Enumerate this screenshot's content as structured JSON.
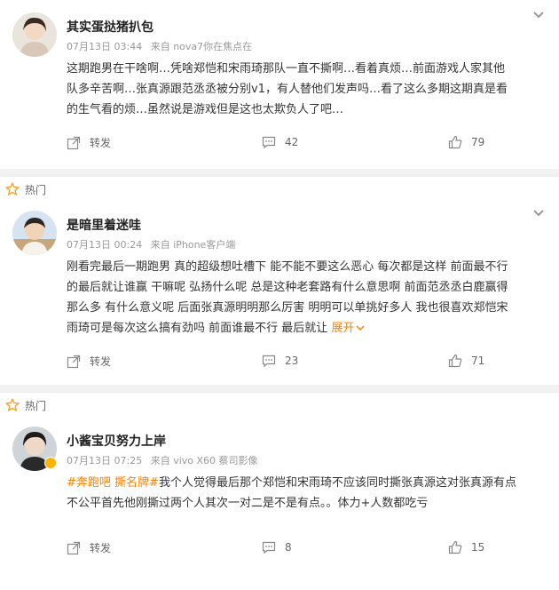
{
  "comments": [
    {
      "name": "其实蛋挞猪扒包",
      "date": "07月13日 03:44",
      "source": "来自 nova7你在焦点在",
      "text_lines": [
        "这期跑男在干啥啊…凭啥郑恺和宋雨琦那队一直不撕啊…看着真烦…前面游戏人家其他",
        "队多辛苦啊…张真源跟范丞丞被分别v1，有人替他们发声吗…看了这么多期这期真是看",
        "的生气看的烦…虽然说是游戏但是这也太欺负人了吧…"
      ],
      "repost_label": "转发",
      "comment_count": "42",
      "like_count": "79"
    },
    {
      "hot_label": "热门",
      "name": "是暗里着迷哇",
      "date": "07月13日 00:24",
      "source": "来自 iPhone客户端",
      "text_lines": [
        "刚看完最后一期跑男 真的超级想吐槽下 能不能不要这么恶心 每次都是这样 前面最不行",
        "的最后就让谁赢 干嘛呢 弘扬什么呢 总是这种老套路有什么意思啊 前面范丞丞白鹿赢得",
        "那么多 有什么意义呢 后面张真源明明那么厉害 明明可以单挑好多人 我也很喜欢郑恺宋",
        "雨琦可是每次这么搞有劲吗 前面谁最不行 最后就让 "
      ],
      "expand_label": "展开",
      "repost_label": "转发",
      "comment_count": "23",
      "like_count": "71"
    },
    {
      "hot_label": "热门",
      "name": "小酱宝贝努力上岸",
      "date": "07月13日 07:25",
      "source": "来自 vivo X60 蔡司影像",
      "tags": [
        "#奔跑吧",
        "撕名牌#"
      ],
      "text_lines": [
        "我个人觉得最后那个郑恺和宋雨琦不应该同时撕张真源这对张真源有点",
        "不公平首先他刚撕过两个人其次一对二是不是有点。。体力+人数都吃亏"
      ],
      "repost_label": "转发",
      "comment_count": "8",
      "like_count": "15"
    }
  ],
  "colors": {
    "accent": "#ff8200",
    "meta": "#999999",
    "badge": "#ffb400"
  }
}
